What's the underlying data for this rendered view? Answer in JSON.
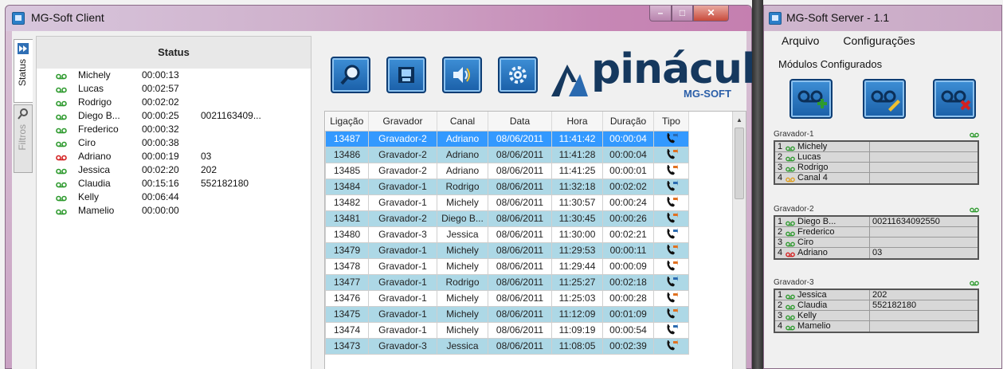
{
  "colors": {
    "green": "#2e9a2e",
    "red": "#d42020",
    "orange": "#e0a020",
    "selected": "#3399ff",
    "alt_row": "#add8e6"
  },
  "client": {
    "title": "MG-Soft Client",
    "tabs": [
      {
        "label": "Status",
        "icon": "fast-forward-icon"
      },
      {
        "label": "Filtros",
        "icon": "search-icon"
      }
    ],
    "status": {
      "header": "Status",
      "rows": [
        {
          "name": "Michely",
          "time": "00:00:13",
          "number": "",
          "color": "green"
        },
        {
          "name": "Lucas",
          "time": "00:02:57",
          "number": "",
          "color": "green"
        },
        {
          "name": "Rodrigo",
          "time": "00:02:02",
          "number": "",
          "color": "green"
        },
        {
          "name": "Diego B...",
          "time": "00:00:25",
          "number": "0021163409...",
          "color": "green"
        },
        {
          "name": "Frederico",
          "time": "00:00:32",
          "number": "",
          "color": "green"
        },
        {
          "name": "Ciro",
          "time": "00:00:38",
          "number": "",
          "color": "green"
        },
        {
          "name": "Adriano",
          "time": "00:00:19",
          "number": "03",
          "color": "red"
        },
        {
          "name": "Jessica",
          "time": "00:02:20",
          "number": "202",
          "color": "green"
        },
        {
          "name": "Claudia",
          "time": "00:15:16",
          "number": "552182180",
          "color": "green"
        },
        {
          "name": "Kelly",
          "time": "00:06:44",
          "number": "",
          "color": "green"
        },
        {
          "name": "Mamelio",
          "time": "00:00:00",
          "number": "",
          "color": "green"
        }
      ]
    },
    "toolbar": [
      {
        "icon": "search-icon"
      },
      {
        "icon": "record-icon"
      },
      {
        "icon": "audio-icon"
      },
      {
        "icon": "settings-gear-icon"
      }
    ],
    "logo": {
      "name": "pináculo",
      "sub": "MG-SOFT"
    },
    "calls": {
      "columns": [
        "Ligação",
        "Gravador",
        "Canal",
        "Data",
        "Hora",
        "Duração",
        "Tipo"
      ],
      "rows": [
        {
          "id": "13487",
          "recorder": "Gravador-2",
          "channel": "Adriano",
          "date": "08/06/2011",
          "time": "11:41:42",
          "duration": "00:00:04"
        },
        {
          "id": "13486",
          "recorder": "Gravador-2",
          "channel": "Adriano",
          "date": "08/06/2011",
          "time": "11:41:28",
          "duration": "00:00:04"
        },
        {
          "id": "13485",
          "recorder": "Gravador-2",
          "channel": "Adriano",
          "date": "08/06/2011",
          "time": "11:41:25",
          "duration": "00:00:01"
        },
        {
          "id": "13484",
          "recorder": "Gravador-1",
          "channel": "Rodrigo",
          "date": "08/06/2011",
          "time": "11:32:18",
          "duration": "00:02:02"
        },
        {
          "id": "13482",
          "recorder": "Gravador-1",
          "channel": "Michely",
          "date": "08/06/2011",
          "time": "11:30:57",
          "duration": "00:00:24"
        },
        {
          "id": "13481",
          "recorder": "Gravador-2",
          "channel": "Diego B...",
          "date": "08/06/2011",
          "time": "11:30:45",
          "duration": "00:00:26"
        },
        {
          "id": "13480",
          "recorder": "Gravador-3",
          "channel": "Jessica",
          "date": "08/06/2011",
          "time": "11:30:00",
          "duration": "00:02:21"
        },
        {
          "id": "13479",
          "recorder": "Gravador-1",
          "channel": "Michely",
          "date": "08/06/2011",
          "time": "11:29:53",
          "duration": "00:00:11"
        },
        {
          "id": "13478",
          "recorder": "Gravador-1",
          "channel": "Michely",
          "date": "08/06/2011",
          "time": "11:29:44",
          "duration": "00:00:09"
        },
        {
          "id": "13477",
          "recorder": "Gravador-1",
          "channel": "Rodrigo",
          "date": "08/06/2011",
          "time": "11:25:27",
          "duration": "00:02:18"
        },
        {
          "id": "13476",
          "recorder": "Gravador-1",
          "channel": "Michely",
          "date": "08/06/2011",
          "time": "11:25:03",
          "duration": "00:00:28"
        },
        {
          "id": "13475",
          "recorder": "Gravador-1",
          "channel": "Michely",
          "date": "08/06/2011",
          "time": "11:12:09",
          "duration": "00:01:09"
        },
        {
          "id": "13474",
          "recorder": "Gravador-1",
          "channel": "Michely",
          "date": "08/06/2011",
          "time": "11:09:19",
          "duration": "00:00:54"
        },
        {
          "id": "13473",
          "recorder": "Gravador-3",
          "channel": "Jessica",
          "date": "08/06/2011",
          "time": "11:08:05",
          "duration": "00:02:39"
        }
      ]
    }
  },
  "server": {
    "title": "MG-Soft Server - 1.1",
    "menu": [
      "Arquivo",
      "Configurações"
    ],
    "modules_title": "Módulos Configurados",
    "buttons": [
      {
        "icon": "add-module-icon"
      },
      {
        "icon": "edit-module-icon"
      },
      {
        "icon": "remove-module-icon"
      }
    ],
    "groups": [
      {
        "name": "Gravador-1",
        "channels": [
          {
            "index": "1",
            "name": "Michely",
            "number": "",
            "color": "green"
          },
          {
            "index": "2",
            "name": "Lucas",
            "number": "",
            "color": "green"
          },
          {
            "index": "3",
            "name": "Rodrigo",
            "number": "",
            "color": "green"
          },
          {
            "index": "4",
            "name": "Canal 4",
            "number": "",
            "color": "orange"
          }
        ]
      },
      {
        "name": "Gravador-2",
        "channels": [
          {
            "index": "1",
            "name": "Diego B...",
            "number": "00211634092550",
            "color": "green"
          },
          {
            "index": "2",
            "name": "Frederico",
            "number": "",
            "color": "green"
          },
          {
            "index": "3",
            "name": "Ciro",
            "number": "",
            "color": "green"
          },
          {
            "index": "4",
            "name": "Adriano",
            "number": "03",
            "color": "red"
          }
        ]
      },
      {
        "name": "Gravador-3",
        "channels": [
          {
            "index": "1",
            "name": "Jessica",
            "number": "202",
            "color": "green"
          },
          {
            "index": "2",
            "name": "Claudia",
            "number": "552182180",
            "color": "green"
          },
          {
            "index": "3",
            "name": "Kelly",
            "number": "",
            "color": "green"
          },
          {
            "index": "4",
            "name": "Mamelio",
            "number": "",
            "color": "green"
          }
        ]
      }
    ]
  }
}
